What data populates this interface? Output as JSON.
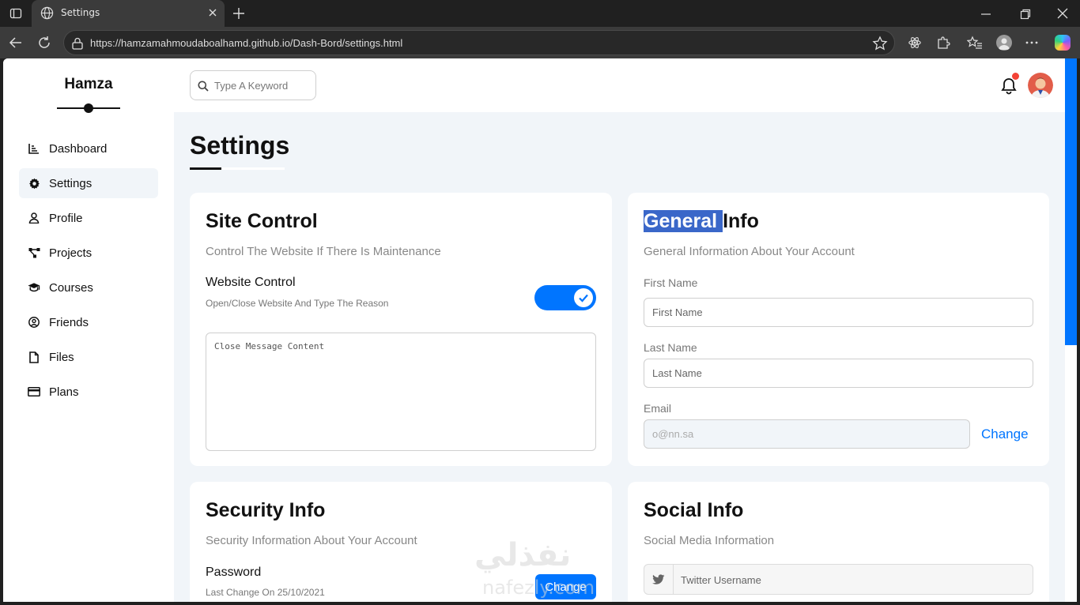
{
  "browser": {
    "tab_title": "Settings",
    "url": "https://hamzamahmoudaboalhamd.github.io/Dash-Bord/settings.html"
  },
  "sidebar": {
    "brand": "Hamza",
    "items": [
      {
        "label": "Dashboard",
        "icon": "chart-icon"
      },
      {
        "label": "Settings",
        "icon": "gear-icon",
        "active": true
      },
      {
        "label": "Profile",
        "icon": "user-icon"
      },
      {
        "label": "Projects",
        "icon": "diagram-icon"
      },
      {
        "label": "Courses",
        "icon": "graduation-cap-icon"
      },
      {
        "label": "Friends",
        "icon": "user-circle-icon"
      },
      {
        "label": "Files",
        "icon": "file-icon"
      },
      {
        "label": "Plans",
        "icon": "credit-card-icon"
      }
    ]
  },
  "header": {
    "search_placeholder": "Type A Keyword",
    "has_notification": true
  },
  "page": {
    "title": "Settings"
  },
  "site_control": {
    "title": "Site Control",
    "subtitle": "Control The Website If There Is Maintenance",
    "toggle_label": "Website Control",
    "toggle_desc": "Open/Close Website And Type The Reason",
    "toggle_on": true,
    "message_placeholder": "Close Message Content"
  },
  "general_info": {
    "title_selected": "General ",
    "title_rest": "Info",
    "subtitle": "General Information About Your Account",
    "first_name_label": "First Name",
    "first_name_placeholder": "First Name",
    "last_name_label": "Last Name",
    "last_name_placeholder": "Last Name",
    "email_label": "Email",
    "email_placeholder": "o@nn.sa",
    "change_label": "Change"
  },
  "security_info": {
    "title": "Security Info",
    "subtitle": "Security Information About Your Account",
    "password_label": "Password",
    "last_change": "Last Change On 25/10/2021",
    "change_button": "Change"
  },
  "social_info": {
    "title": "Social Info",
    "subtitle": "Social Media Information",
    "twitter_placeholder": "Twitter Username"
  },
  "watermark": {
    "arabic": "نفذلي",
    "latin": "nafezly.com"
  },
  "colors": {
    "accent": "#0075ff",
    "page_bg": "#f1f5f9",
    "selection": "#3a67c9",
    "notification": "#f44336"
  }
}
